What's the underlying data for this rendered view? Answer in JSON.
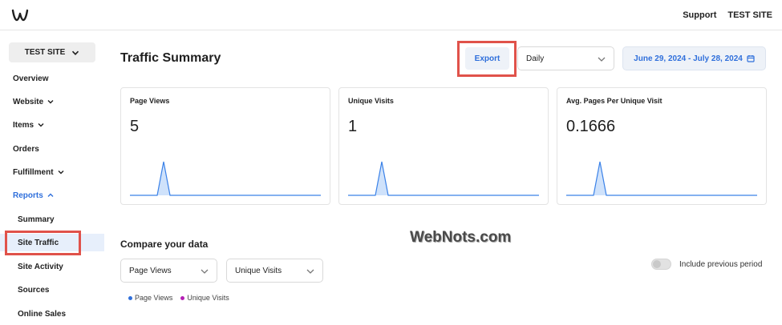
{
  "topbar": {
    "support": "Support",
    "site": "TEST SITE"
  },
  "sidebar": {
    "site_select": "TEST SITE",
    "items": [
      {
        "label": "Overview"
      },
      {
        "label": "Website"
      },
      {
        "label": "Items"
      },
      {
        "label": "Orders"
      },
      {
        "label": "Fulfillment"
      },
      {
        "label": "Reports"
      },
      {
        "label": "Summary"
      },
      {
        "label": "Site Traffic"
      },
      {
        "label": "Site Activity"
      },
      {
        "label": "Sources"
      },
      {
        "label": "Online Sales"
      }
    ]
  },
  "main": {
    "title": "Traffic Summary",
    "export": "Export",
    "frequency": "Daily",
    "date_range": "June 29, 2024 - July 28, 2024"
  },
  "cards": [
    {
      "title": "Page Views",
      "value": "5"
    },
    {
      "title": "Unique Visits",
      "value": "1"
    },
    {
      "title": "Avg. Pages Per Unique Visit",
      "value": "0.1666"
    }
  ],
  "compare": {
    "title": "Compare your data",
    "metric1": "Page Views",
    "metric2": "Unique Visits",
    "toggle_label": "Include previous period",
    "legend": [
      {
        "label": "Page Views",
        "color": "#2f6fdb"
      },
      {
        "label": "Unique Visits",
        "color": "#b51fb5"
      }
    ]
  },
  "watermark": "WebNots.com",
  "colors": {
    "accent": "#2f6fdb",
    "highlight": "#e0524a",
    "spark_line": "#3b82e8",
    "spark_fill": "#cfe2fb"
  }
}
